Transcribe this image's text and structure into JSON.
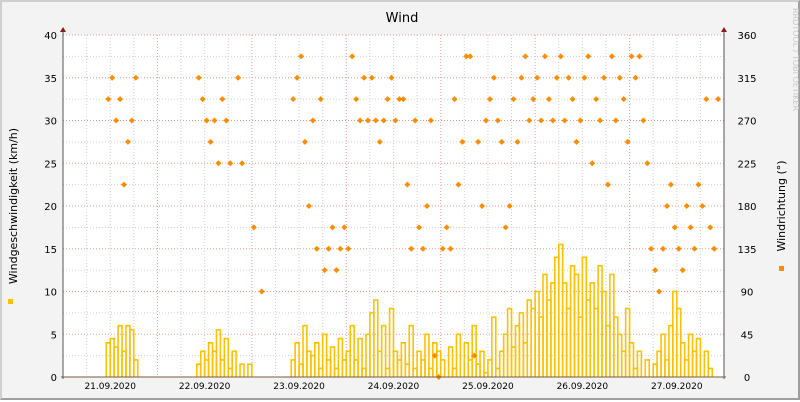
{
  "chart_data": {
    "type": "line",
    "title": "Wind",
    "ylabel": "Windgeschwindigkeit (km/h)",
    "ylabel_right": "Windrichtung (°)",
    "watermark": "RRDTOOL / TOBI OETIKER",
    "ylim": [
      0,
      40
    ],
    "ylim_right": [
      0,
      360
    ],
    "yticks": [
      0,
      5,
      10,
      15,
      20,
      25,
      30,
      35,
      40
    ],
    "yticks_right": [
      0,
      45,
      90,
      135,
      180,
      225,
      270,
      315,
      360
    ],
    "x_range_hours": [
      0,
      168
    ],
    "x_tick_labels": [
      "21.09.2020",
      "22.09.2020",
      "23.09.2020",
      "24.09.2020",
      "25.09.2020",
      "26.09.2020",
      "27.09.2020"
    ],
    "grid": true,
    "legend_placement": "beside-axis-labels",
    "series": [
      {
        "name": "Windgeschwindigkeit (km/h)",
        "type": "step",
        "color": "#ffc000",
        "axis": "left",
        "hourly_values": [
          0,
          0,
          0,
          0,
          0,
          0,
          0,
          0,
          0,
          0,
          0,
          4,
          4.5,
          3.5,
          6,
          3,
          6,
          5.5,
          2,
          0,
          0,
          0,
          0,
          0,
          0,
          0,
          0,
          0,
          0,
          0,
          0,
          0,
          0,
          0,
          1.5,
          3,
          2,
          4,
          3,
          5.5,
          2,
          4.5,
          1,
          3,
          0,
          1.5,
          0,
          1.5,
          0,
          0,
          0,
          0,
          0,
          0,
          0,
          0,
          0,
          0,
          2,
          4,
          1.5,
          6,
          3,
          2.5,
          4,
          1,
          5,
          2,
          3.5,
          1,
          4.5,
          2,
          3,
          6,
          2,
          4.5,
          1,
          5,
          7.5,
          9,
          3,
          6,
          1,
          8,
          3,
          2,
          4,
          1.5,
          6,
          1,
          3,
          2,
          5,
          1,
          4,
          3,
          2,
          0,
          3.5,
          1,
          5,
          0,
          4,
          2,
          6,
          1.5,
          3,
          0.5,
          2,
          7,
          1,
          3,
          5,
          8,
          3.5,
          6,
          7.5,
          4,
          9,
          8,
          10,
          7,
          12,
          9,
          11,
          14,
          15.5,
          11,
          8,
          13,
          12,
          7,
          14,
          9,
          11,
          8,
          13,
          10,
          6,
          12,
          7,
          5,
          3,
          8,
          4,
          1,
          3,
          0,
          2,
          0,
          1.5,
          3,
          5,
          2,
          6,
          10,
          8,
          4,
          2,
          5,
          3,
          4.5,
          0,
          3,
          1,
          0,
          0,
          0
        ]
      },
      {
        "name": "Windrichtung (°)",
        "type": "scatter",
        "color": "#ff8c00",
        "axis": "right",
        "hourly_values": [
          null,
          null,
          null,
          null,
          null,
          null,
          null,
          null,
          null,
          null,
          null,
          292.5,
          315,
          270,
          292.5,
          202.5,
          247.5,
          270,
          315,
          null,
          null,
          null,
          null,
          null,
          null,
          null,
          null,
          null,
          null,
          null,
          null,
          null,
          null,
          null,
          315,
          292.5,
          270,
          247.5,
          270,
          225,
          292.5,
          270,
          225,
          null,
          315,
          225,
          null,
          null,
          157.5,
          null,
          90,
          null,
          null,
          null,
          null,
          null,
          null,
          null,
          292.5,
          315,
          337.5,
          247.5,
          180,
          270,
          135,
          292.5,
          112.5,
          135,
          157.5,
          112.5,
          135,
          157.5,
          135,
          337.5,
          292.5,
          270,
          315,
          270,
          315,
          270,
          247.5,
          270,
          292.5,
          315,
          270,
          292.5,
          292.5,
          202.5,
          135,
          270,
          157.5,
          135,
          180,
          270,
          22.5,
          0,
          135,
          157.5,
          135,
          292.5,
          202.5,
          247.5,
          337.5,
          337.5,
          22.5,
          247.5,
          180,
          270,
          292.5,
          315,
          270,
          247.5,
          157.5,
          180,
          292.5,
          247.5,
          315,
          337.5,
          270,
          292.5,
          315,
          270,
          337.5,
          292.5,
          270,
          315,
          337.5,
          270,
          315,
          292.5,
          247.5,
          270,
          315,
          337.5,
          225,
          292.5,
          270,
          315,
          202.5,
          337.5,
          270,
          315,
          292.5,
          247.5,
          337.5,
          315,
          337.5,
          270,
          225,
          135,
          112.5,
          90,
          135,
          180,
          202.5,
          157.5,
          135,
          112.5,
          180,
          157.5,
          135,
          202.5,
          180,
          292.5,
          157.5,
          135,
          292.5,
          null
        ]
      }
    ]
  }
}
